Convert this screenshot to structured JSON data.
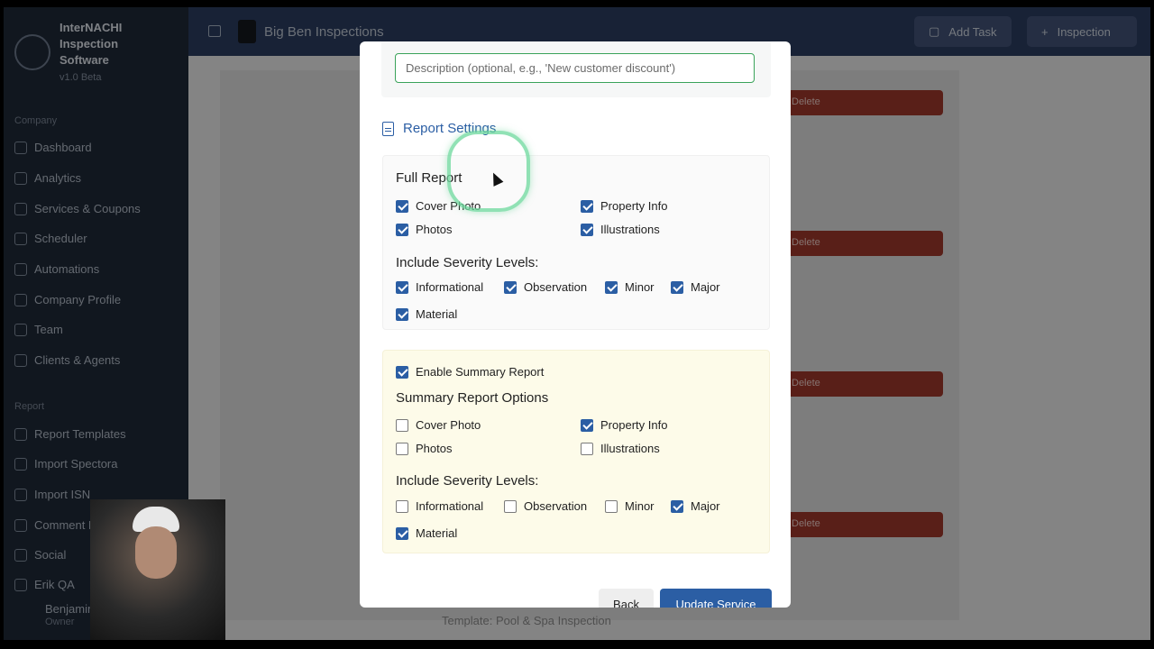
{
  "app": {
    "name": "InterNACHI Inspection Software",
    "version": "v1.0 Beta"
  },
  "sidebar": {
    "section_company": "Company",
    "company_items": [
      {
        "label": "Dashboard",
        "icon": "grid-icon"
      },
      {
        "label": "Analytics",
        "icon": "bar-chart-icon"
      },
      {
        "label": "Services & Coupons",
        "icon": "layers-icon"
      },
      {
        "label": "Scheduler",
        "icon": "calendar-icon"
      },
      {
        "label": "Automations",
        "icon": "bolt-icon"
      },
      {
        "label": "Company Profile",
        "icon": "building-icon"
      },
      {
        "label": "Team",
        "icon": "user-icon"
      },
      {
        "label": "Clients & Agents",
        "icon": "users-icon"
      }
    ],
    "section_report": "Report",
    "report_items": [
      {
        "label": "Report Templates",
        "icon": "file-icon"
      },
      {
        "label": "Import Spectora",
        "icon": "upload-icon"
      },
      {
        "label": "Import ISN",
        "icon": "upload-icon"
      },
      {
        "label": "Comment Library",
        "icon": "database-icon"
      },
      {
        "label": "Social",
        "icon": "share-icon"
      },
      {
        "label": "Erik QA",
        "icon": "grid-icon"
      }
    ],
    "user": {
      "name": "Benjamin",
      "role": "Owner"
    }
  },
  "header": {
    "company_name": "Big Ben Inspections",
    "add_task_label": "Add Task",
    "inspection_label": "Inspection"
  },
  "background": {
    "delete_label": "Delete",
    "template_text": "Template: Pool & Spa Inspection"
  },
  "modal": {
    "description_placeholder": "Description (optional, e.g., 'New customer discount')",
    "report_settings_title": "Report Settings",
    "full_report": {
      "heading": "Full Report",
      "options": [
        {
          "label": "Cover Photo",
          "checked": true
        },
        {
          "label": "Property Info",
          "checked": true
        },
        {
          "label": "Photos",
          "checked": true
        },
        {
          "label": "Illustrations",
          "checked": true
        }
      ],
      "severity_heading": "Include Severity Levels:",
      "severity": [
        {
          "label": "Informational",
          "checked": true
        },
        {
          "label": "Observation",
          "checked": true
        },
        {
          "label": "Minor",
          "checked": true
        },
        {
          "label": "Major",
          "checked": true
        },
        {
          "label": "Material",
          "checked": true
        }
      ]
    },
    "summary_report": {
      "enable_label": "Enable Summary Report",
      "enable_checked": true,
      "heading": "Summary Report Options",
      "options": [
        {
          "label": "Cover Photo",
          "checked": false
        },
        {
          "label": "Property Info",
          "checked": true
        },
        {
          "label": "Photos",
          "checked": false
        },
        {
          "label": "Illustrations",
          "checked": false
        }
      ],
      "severity_heading": "Include Severity Levels:",
      "severity": [
        {
          "label": "Informational",
          "checked": false
        },
        {
          "label": "Observation",
          "checked": false
        },
        {
          "label": "Minor",
          "checked": false
        },
        {
          "label": "Major",
          "checked": true
        },
        {
          "label": "Material",
          "checked": true
        }
      ]
    },
    "back_label": "Back",
    "update_label": "Update Service"
  },
  "colors": {
    "primary": "#2b5ea4",
    "sidebar_bg": "#1f2a3a",
    "header_bg": "#2c3e63",
    "summary_panel_bg": "#fdfbe9",
    "delete_red": "#a33a2d"
  }
}
